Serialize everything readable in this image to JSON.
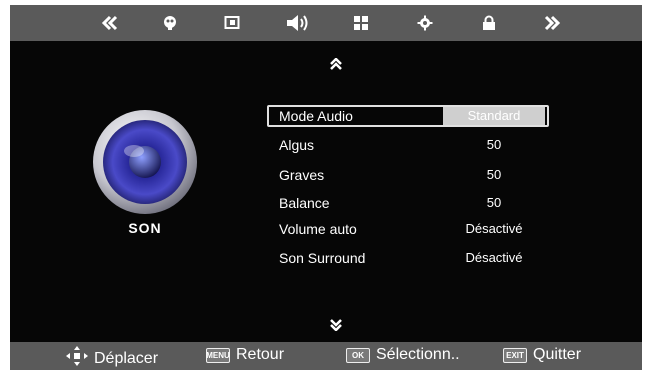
{
  "nav": {
    "icons": [
      "chevron-left-double-icon",
      "picture-icon",
      "screen-icon",
      "speaker-icon",
      "grid-icon",
      "gear-icon",
      "lock-icon",
      "chevron-right-double-icon"
    ],
    "active": "speaker-icon"
  },
  "section": {
    "title": "SON"
  },
  "menu": {
    "items": [
      {
        "label": "Mode Audio",
        "value": "Standard"
      },
      {
        "label": "Algus",
        "value": "50"
      },
      {
        "label": "Graves",
        "value": "50"
      },
      {
        "label": "Balance",
        "value": "50"
      },
      {
        "label": "Volume auto",
        "value": "Désactivé"
      },
      {
        "label": "Son Surround",
        "value": "Désactivé"
      }
    ]
  },
  "footer": {
    "move_label": "Déplacer",
    "back_key": "MENU",
    "back_label": "Retour",
    "select_key": "OK",
    "select_label": "Sélectionn..",
    "exit_key": "EXIT",
    "exit_label": "Quitter"
  },
  "colors": {
    "bar": "#5a5a5a",
    "background": "#060606",
    "highlight": "#cfcfcf"
  }
}
